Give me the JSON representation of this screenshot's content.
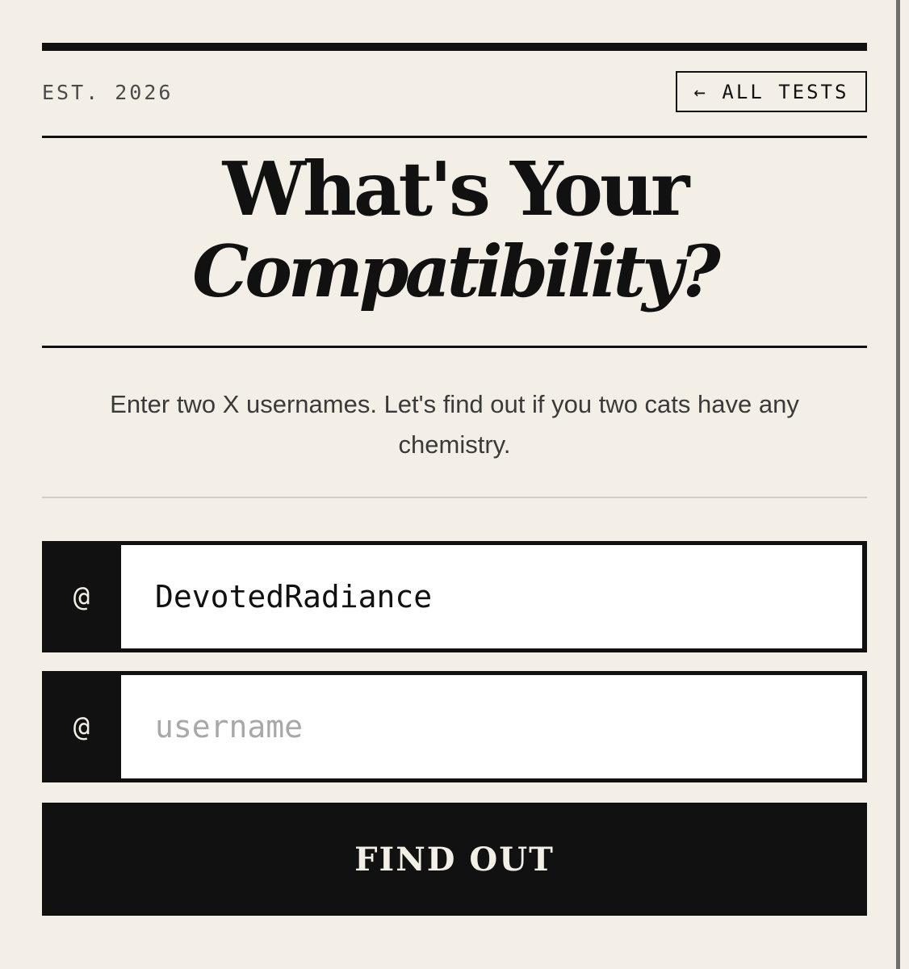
{
  "header": {
    "est_label": "EST. 2026",
    "all_tests_label": "← ALL TESTS"
  },
  "title": {
    "line1": "What's Your",
    "line2": "Compatibility?"
  },
  "subtitle": "Enter two X usernames. Let's find out if you two cats have any chemistry.",
  "form": {
    "at_symbol": "@",
    "username_1": {
      "value": "DevotedRadiance",
      "placeholder": "username"
    },
    "username_2": {
      "value": "",
      "placeholder": "username"
    },
    "submit_label": "FIND OUT"
  },
  "colors": {
    "background": "#f3efe7",
    "ink": "#111111",
    "input_background": "#ffffff",
    "placeholder": "#a8a8a8"
  }
}
